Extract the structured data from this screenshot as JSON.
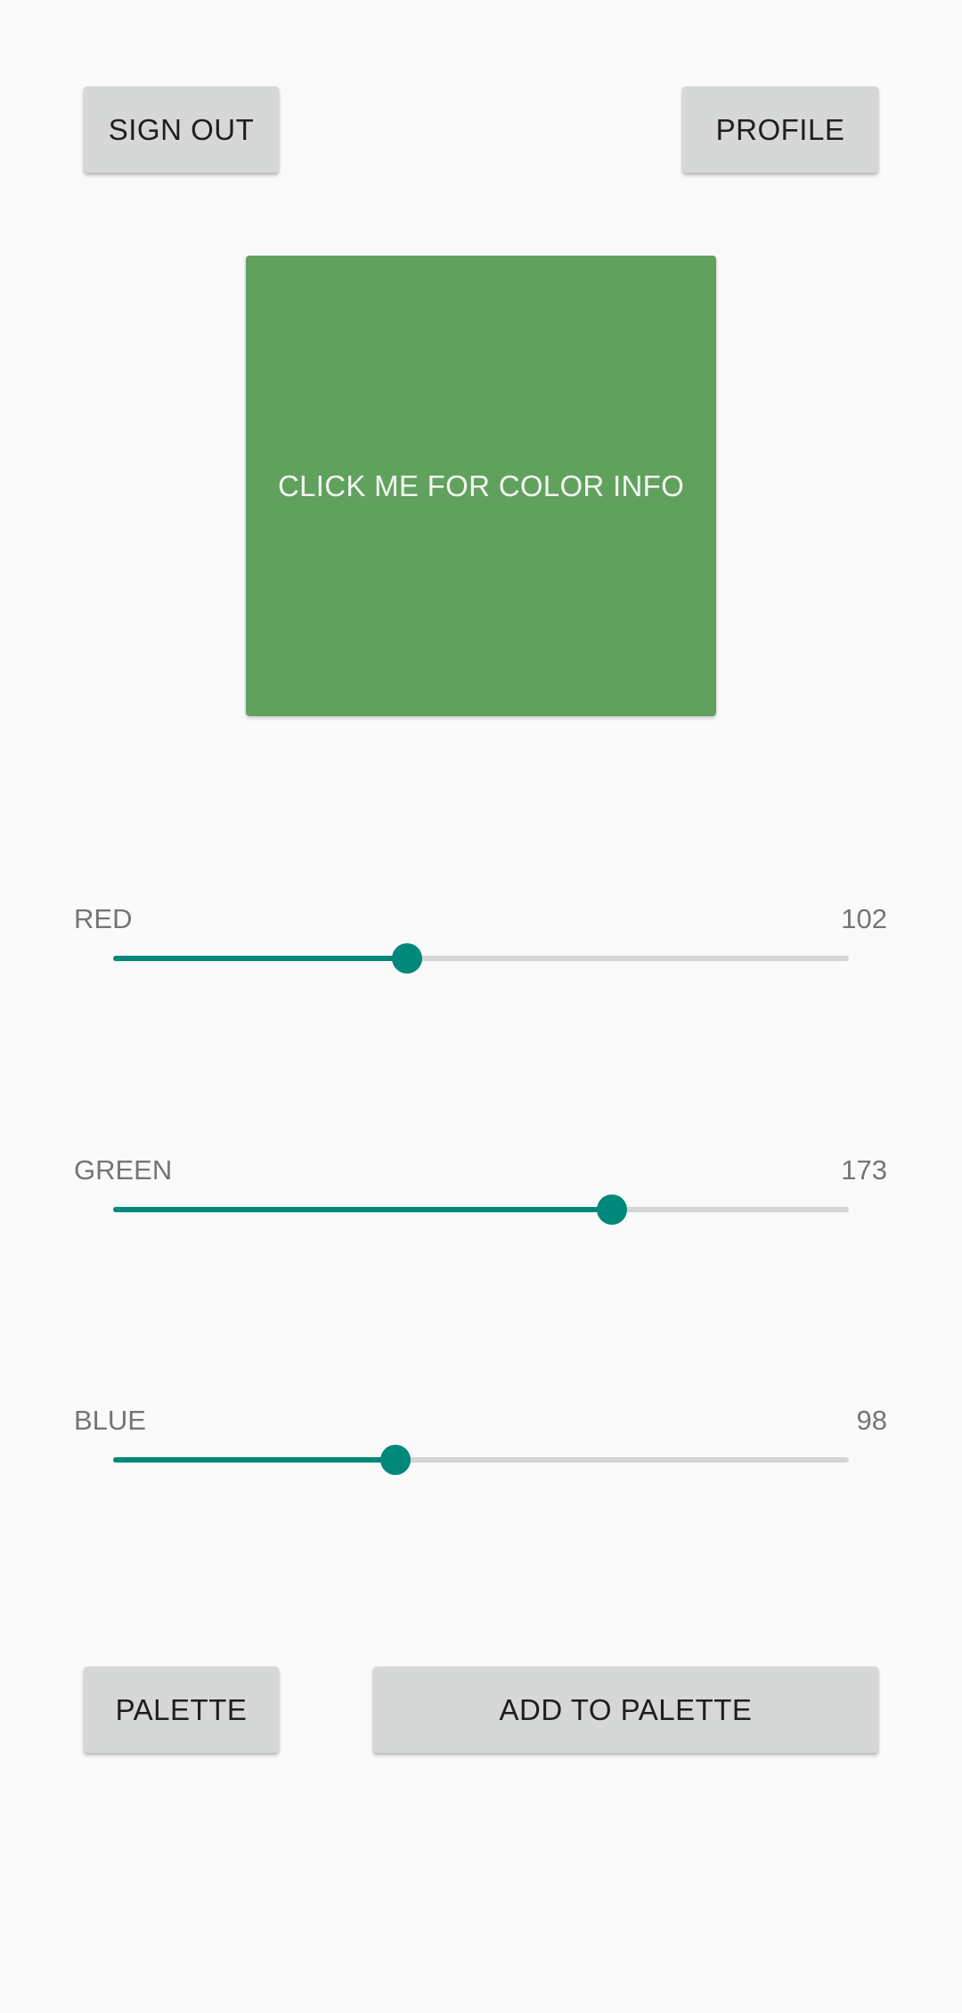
{
  "header": {
    "sign_out_label": "SIGN OUT",
    "profile_label": "PROFILE"
  },
  "swatch": {
    "label": "CLICK ME FOR COLOR INFO",
    "color": "#61a15e"
  },
  "sliders": [
    {
      "label": "RED",
      "value": "102",
      "fraction": 0.4
    },
    {
      "label": "GREEN",
      "value": "173",
      "fraction": 0.678
    },
    {
      "label": "BLUE",
      "value": "98",
      "fraction": 0.384
    }
  ],
  "footer": {
    "palette_label": "PALETTE",
    "add_to_palette_label": "ADD TO PALETTE"
  },
  "colors": {
    "accent": "#00887a",
    "track": "#d4d4d4",
    "button_bg": "#d6d7d7",
    "background": "#fafafa"
  }
}
